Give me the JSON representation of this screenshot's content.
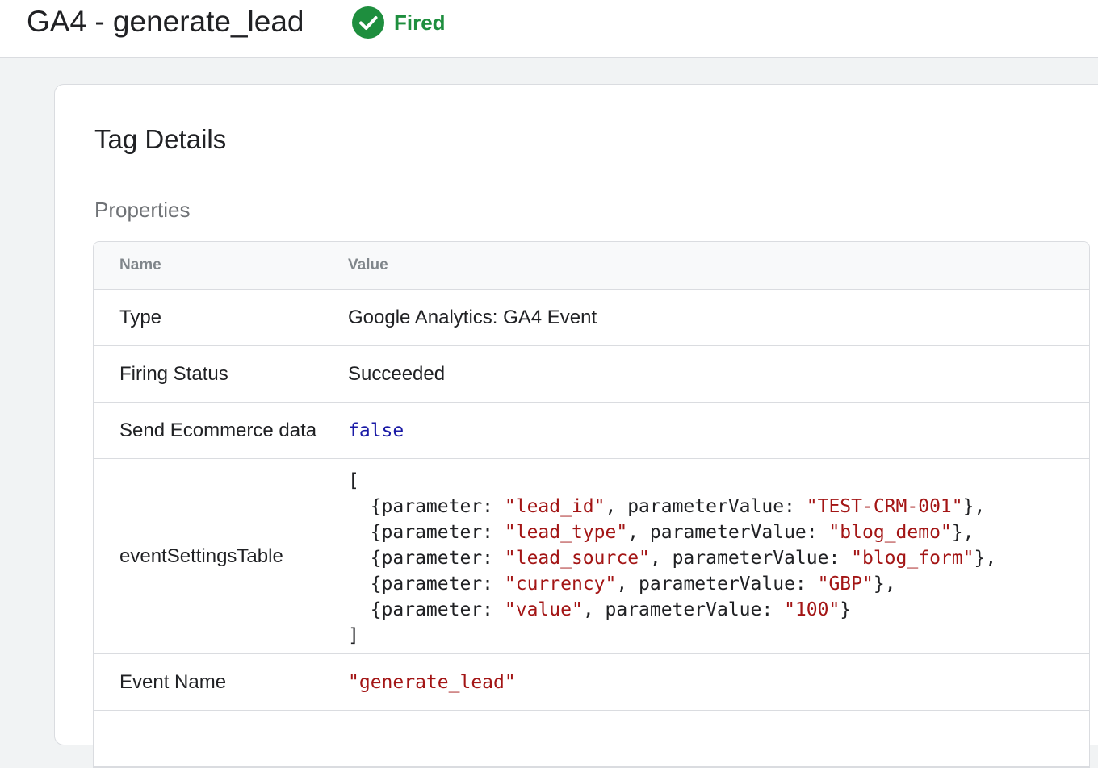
{
  "header": {
    "title": "GA4 - generate_lead",
    "status_label": "Fired",
    "status_icon": "check-circle-icon",
    "status_color": "#1e8e3e"
  },
  "card": {
    "title": "Tag Details",
    "section_title": "Properties"
  },
  "table": {
    "columns": [
      "Name",
      "Value"
    ],
    "rows": [
      {
        "name": "Type",
        "value": "Google Analytics: GA4 Event"
      },
      {
        "name": "Firing Status",
        "value": "Succeeded"
      },
      {
        "name": "Send Ecommerce data",
        "value": "false"
      },
      {
        "name": "eventSettingsTable",
        "value_lines": [
          {
            "parameter": "\"lead_id\"",
            "parameterValue": "\"TEST-CRM-001\""
          },
          {
            "parameter": "\"lead_type\"",
            "parameterValue": "\"blog_demo\""
          },
          {
            "parameter": "\"lead_source\"",
            "parameterValue": "\"blog_form\""
          },
          {
            "parameter": "\"currency\"",
            "parameterValue": "\"GBP\""
          },
          {
            "parameter": "\"value\"",
            "parameterValue": "\"100\""
          }
        ]
      },
      {
        "name": "Event Name",
        "value": "\"generate_lead\""
      }
    ]
  }
}
